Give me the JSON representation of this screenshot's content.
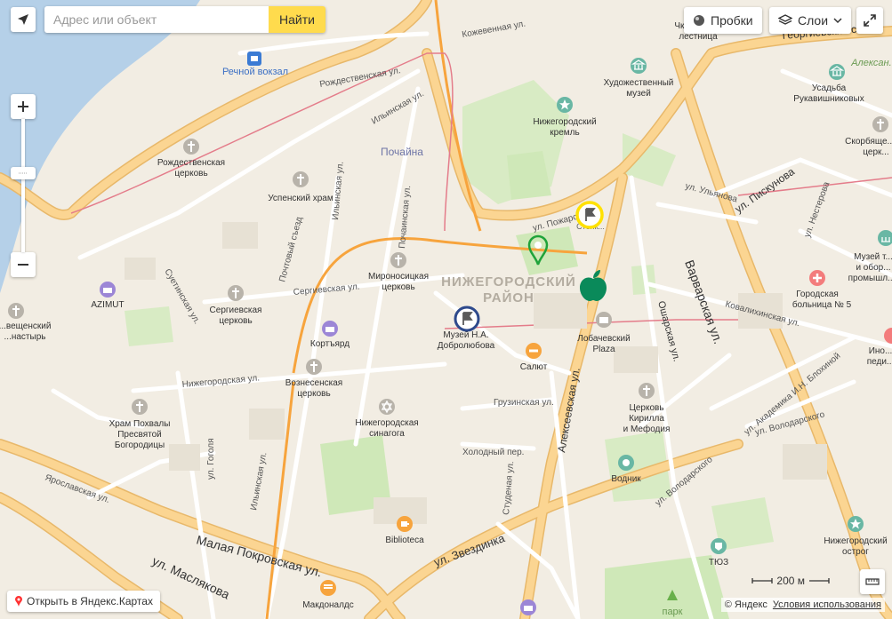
{
  "search": {
    "placeholder": "Адрес или объект",
    "button_label": "Найти"
  },
  "controls": {
    "traffic_label": "Пробки",
    "layers_label": "Слои",
    "scale_label": "200 м",
    "open_in_label": "Открыть в Яндекс.Картах",
    "copyright": "© Яндекс",
    "terms_label": "Условия использования"
  },
  "district": {
    "line1": "НИЖЕГОРОДСКИЙ",
    "line2": "РАЙОН"
  },
  "streets": {
    "kozhevennaya": "Кожевенная ул.",
    "rozhdestvenskaya": "Рождественская ул.",
    "ilyinskaya_top": "Ильинская ул.",
    "ilyinskaya_mid": "Ильинская ул.",
    "ilyinskaya_bottom": "Ильинская ул.",
    "pochtovy": "Почтовый съезд",
    "pochainskaya": "Почаинская ул.",
    "sergievskaya": "Сергиевская ул.",
    "suetinskaya": "Суетинская ул.",
    "nizhegorodskaya": "Нижегородская ул.",
    "gogolya": "ул. Гоголя",
    "yaroslavskaya": "Ярославская ул.",
    "malaya_pokrovskaya": "Малая Покровская ул.",
    "maslyakova": "ул. Маслякова",
    "zvezdinka": "ул. Звездинка",
    "studenaya": "Студеная ул.",
    "kholodny": "Холодный пер.",
    "gruzinskaya": "Грузинская ул.",
    "alekseevskaya": "Алексеевская ул.",
    "osharskaya": "Ошарская ул.",
    "varvarskaya": "Варварская ул.",
    "kovalikhinskaya": "Ковалихинская ул.",
    "akademika": "ул. Академика И.Н. Блохиной",
    "volodarskogo_right": "ул. Володарского",
    "volodarskogo_left": "ул. Володарского",
    "pozharskogo": "ул. Пожарского",
    "ulyanova": "ул. Ульянова",
    "piskunova": "ул. Пискунова",
    "nesterova": "ул. Нестерова",
    "georgievsky": "Георгиевский съезд"
  },
  "pois": {
    "rechnoy": "Речной вокзал",
    "pochayna": "Почайна",
    "rozhd_church1": "Рождественская",
    "rozhd_church2": "церковь",
    "uspensky": "Успенский храм",
    "mironositskaya1": "Мироносицкая",
    "mironositskaya2": "церковь",
    "sergievskaya1": "Сергиевская",
    "sergievskaya2": "церковь",
    "azimut": "AZIMUT",
    "vvedensky1": "...вещенский",
    "vvedensky2": "...настырь",
    "kortyard": "Кортъярд",
    "voznesenskaya1": "Вознесенская",
    "voznesenskaya2": "церковь",
    "khram1": "Храм Похвалы",
    "khram2": "Пресвятой",
    "khram3": "Богородицы",
    "sinagoga1": "Нижегородская",
    "sinagoga2": "синагога",
    "muzey1": "Музей Н.А.",
    "muzey2": "Добролюбова",
    "salyut": "Салют",
    "lobachevsky1": "Лобачевский",
    "lobachevsky2": "Plaza",
    "kreml1": "Нижегородский",
    "kreml2": "кремль",
    "khudozh1": "Художественный",
    "khudozh2": "музей",
    "usadba1": "Усадьба",
    "usadba2": "Рукавишниковых",
    "skorbyash1": "Скорбяще...",
    "skorbyash2": "церк...",
    "lestnica1": "Чк...",
    "lestnica2": "лестница",
    "muzey_teatr1": "Музей т...",
    "muzey_teatr2": "и обор...",
    "muzey_teatr3": "промышл...",
    "bolnica1": "Городская",
    "bolnica2": "больница № 5",
    "tserkov_kirilla1": "Церковь",
    "tserkov_kirilla2": "Кирилла",
    "tserkov_kirilla3": "и Мефодия",
    "vodnik": "Водник",
    "tyuz": "ТЮЗ",
    "ostrog1": "Нижегородский",
    "ostrog2": "острог",
    "biblioteca": "Biblioteca",
    "makdonalds": "Макдоналдс",
    "park": "парк",
    "inost1": "Ино...",
    "inost2": "педи...",
    "alexan": "Алексан...",
    "plaza_sign": "Спорт",
    "pozh_sign": "Стопк..."
  },
  "colors": {
    "accent_yellow": "#ffdb4d",
    "road": "#fbd592",
    "road_edge": "#e8b86a",
    "water": "#b5d0e8",
    "park": "#cfe8b8",
    "marker_blue": "#2e4a8c",
    "marker_yellow": "#ffe100",
    "marker_green": "#1fa33a",
    "apple_green": "#0a8a5a"
  }
}
